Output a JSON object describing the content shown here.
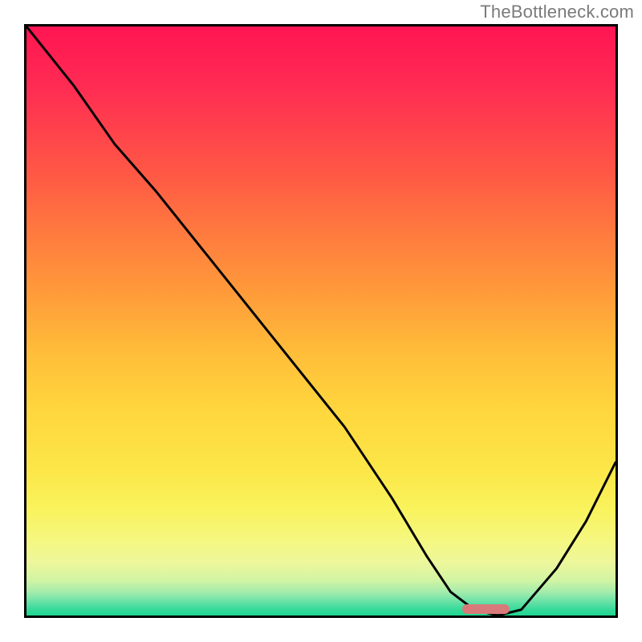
{
  "watermark": "TheBottleneck.com",
  "chart_data": {
    "type": "line",
    "title": "",
    "xlabel": "",
    "ylabel": "",
    "x_range": [
      0,
      100
    ],
    "y_range": [
      0,
      100
    ],
    "grid": false,
    "legend": false,
    "series": [
      {
        "name": "bottleneck-curve",
        "x": [
          0,
          8,
          15,
          22,
          30,
          38,
          46,
          54,
          62,
          68,
          72,
          76,
          80,
          84,
          90,
          95,
          100
        ],
        "y": [
          100,
          90,
          80,
          72,
          62,
          52,
          42,
          32,
          20,
          10,
          4,
          1,
          0,
          1,
          8,
          16,
          26
        ]
      }
    ],
    "gradient_stops": [
      {
        "pos": 0,
        "color": "#ff1552"
      },
      {
        "pos": 0.25,
        "color": "#ff5845"
      },
      {
        "pos": 0.55,
        "color": "#ffbc39"
      },
      {
        "pos": 0.82,
        "color": "#f9f35d"
      },
      {
        "pos": 0.96,
        "color": "#a4ecac"
      },
      {
        "pos": 1.0,
        "color": "#1ed68f"
      }
    ],
    "marker": {
      "name": "optimal-range",
      "x_start": 74,
      "x_end": 82,
      "y": 0,
      "color": "#d97a7a"
    }
  }
}
